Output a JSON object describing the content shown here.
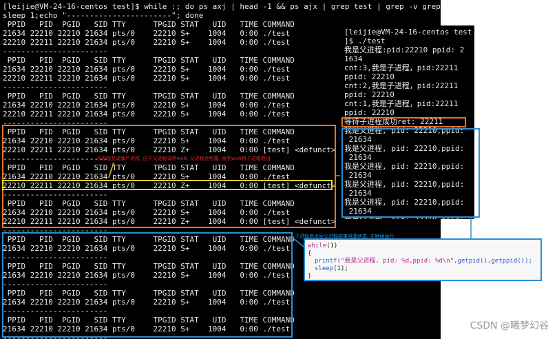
{
  "terminal": {
    "lines": [
      "[leijie@VM-24-16-centos test]$ while :; do ps axj | head -1 && ps ajx | grep test | grep -v grep;",
      "sleep 1;echo \"-----------------------\"; done",
      " PPID   PID  PGID   SID TTY      TPGID STAT   UID   TIME COMMAND",
      "21634 22210 22210 21634 pts/0    22210 S+    1004   0:00 ./test",
      "22210 22211 22210 21634 pts/0    22210 S+    1004   0:00 ./test",
      "-----------------------",
      " PPID   PID  PGID   SID TTY      TPGID STAT   UID   TIME COMMAND",
      "21634 22210 22210 21634 pts/0    22210 S+    1004   0:00 ./test",
      "22210 22211 22210 21634 pts/0    22210 S+    1004   0:00 ./test",
      "-----------------------",
      " PPID   PID  PGID   SID TTY      TPGID STAT   UID   TIME COMMAND",
      "21634 22210 22210 21634 pts/0    22210 S+    1004   0:00 ./test",
      "22210 22211 22210 21634 pts/0    22210 S+    1004   0:00 ./test",
      "-----------------------",
      " PPID   PID  PGID   SID TTY      TPGID STAT   UID   TIME COMMAND",
      "21634 22210 22210 21634 pts/0    22210 S+    1004   0:00 ./test",
      "22210 22211 22210 21634 pts/0    22210 Z+    1004   0:00 [test] <defunct>",
      "-----------------------",
      " PPID   PID  PGID   SID TTY      TPGID STAT   UID   TIME COMMAND",
      "21634 22210 22210 21634 pts/0    22210 S+    1004   0:00 ./test",
      "22210 22211 22210 21634 pts/0    22210 Z+    1004   0:00 [test] <defunct>",
      "-----------------------",
      " PPID   PID  PGID   SID TTY      TPGID STAT   UID   TIME COMMAND",
      "21634 22210 22210 21634 pts/0    22210 S+    1004   0:00 ./test",
      "22210 22211 22210 21634 pts/0    22210 Z+    1004   0:00 [test] <defunct>",
      "-----------------------",
      " PPID   PID  PGID   SID TTY      TPGID STAT   UID   TIME COMMAND",
      "21634 22210 22210 21634 pts/0    22210 S+    1004   0:00 ./test",
      "-----------------------",
      " PPID   PID  PGID   SID TTY      TPGID STAT   UID   TIME COMMAND",
      "21634 22210 22210 21634 pts/0    22210 S+    1004   0:00 ./test",
      "-----------------------",
      " PPID   PID  PGID   SID TTY      TPGID STAT   UID   TIME COMMAND",
      "21634 22210 22210 21634 pts/0    22210 S+    1004   0:00 ./test",
      "-----------------------",
      " PPID   PID  PGID   SID TTY      TPGID STAT   UID   TIME COMMAND",
      "21634 22210 22210 21634 pts/0    22210 S+    1004   0:00 ./test",
      "-----------------------"
    ]
  },
  "side_terminal": {
    "lines": [
      "[leijie@VM-24-16-centos test",
      "]$ ./test",
      "我是父进程:pid:22210 ppid: 2",
      "1634",
      "cnt:3,我是子进程，pid:22211",
      "ppid: 22210",
      "cnt:2,我是子进程，pid:22211",
      "ppid: 22210",
      "cnt:1,我是子进程，pid:22211",
      "ppid: 22210",
      "等待子进程成功ret: 22211",
      "我是父进程, pid: 22210,ppid:",
      " 21634",
      "我是父进程, pid: 22210,ppid:",
      " 21634",
      "我是父进程, pid: 22210,ppid:",
      " 21634",
      "我是父进程, pid: 22210,ppid:",
      " 21634",
      "我是父进程, pid: 22210,ppid:",
      " 21634",
      "我是父进程, pid: 22210,ppid:"
    ]
  },
  "annotations": {
    "zombie_note": "子进程变成僵尸进程, 由于父进程调用wait, 父进程会阻塞, 直到wait将子进程退出",
    "blocking_note": "子进程退出后父进程结束阻塞状态, 才继续运行"
  },
  "code": {
    "line1_kw": "while",
    "line1_rest": "(1)",
    "line2": "{",
    "line3_fn": "printf",
    "line3_str": "(\"我是父进程, pid: %d,ppid: %d\\n\"",
    "line3_rest": ",getpid(),getppid());",
    "line4_fn": "sleep",
    "line4_rest": "(1);",
    "line5": "}"
  },
  "watermark": "CSDN @曦梦幻谷",
  "colors": {
    "orange": "#e8732a",
    "blue": "#2b8fd6",
    "yellow": "#e7d21b",
    "note_red": "#e0242a",
    "note_blue": "#2b8fd6"
  }
}
